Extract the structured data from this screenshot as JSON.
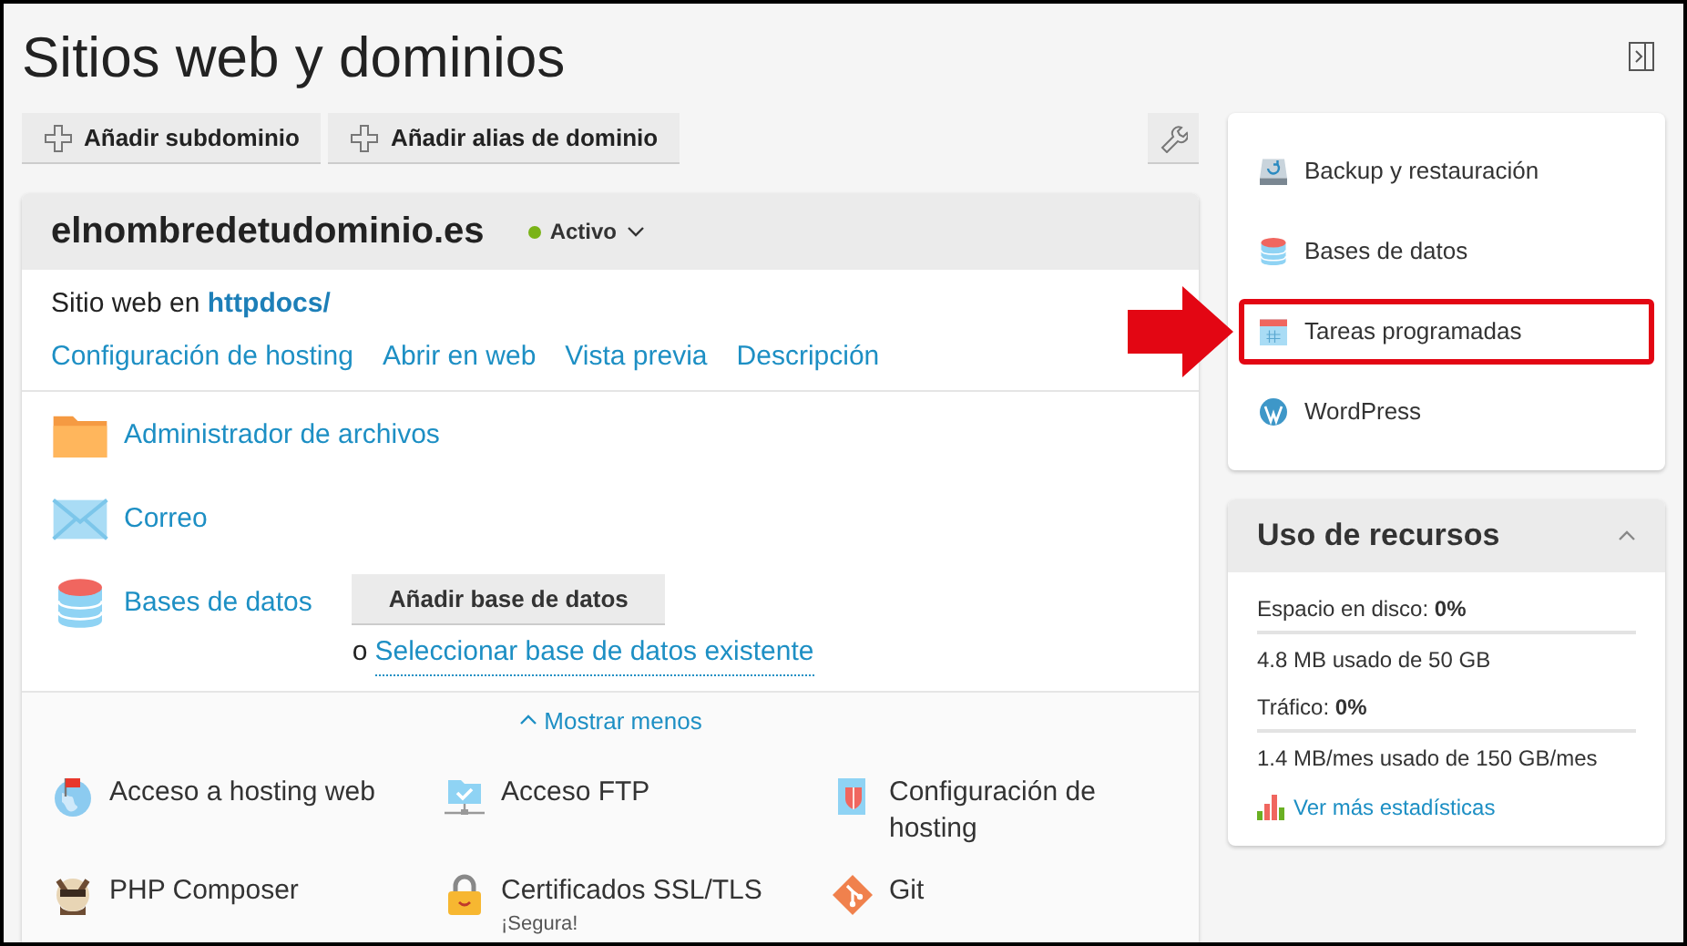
{
  "page": {
    "title": "Sitios web y dominios"
  },
  "toolbar": {
    "buttons": [
      "Añadir subdominio",
      "Añadir alias de dominio"
    ]
  },
  "domain": {
    "name": "elnombredetudominio.es",
    "status": "Activo",
    "site_prefix": "Sitio web en",
    "site_link": "httpdocs/",
    "links": [
      "Configuración de hosting",
      "Abrir en web",
      "Vista previa",
      "Descripción"
    ],
    "services": [
      {
        "kind": "folder",
        "label": "Administrador de archivos"
      },
      {
        "kind": "mail",
        "label": "Correo"
      },
      {
        "kind": "database",
        "label": "Bases de datos",
        "button": "Añadir base de datos",
        "alt_prefix": "o",
        "alt_link": "Seleccionar base de datos existente"
      }
    ],
    "toggle": {
      "label": "Mostrar menos",
      "expanded": true
    },
    "tools": [
      {
        "kind": "globe",
        "label": "Acceso a hosting web"
      },
      {
        "kind": "ftp",
        "label": "Acceso FTP"
      },
      {
        "kind": "scroll",
        "label": "Configuración de hosting"
      },
      {
        "kind": "composer",
        "label": "PHP Composer"
      },
      {
        "kind": "lock",
        "label": "Certificados SSL/TLS",
        "note": "¡Segura!"
      },
      {
        "kind": "git",
        "label": "Git"
      }
    ]
  },
  "sidebar": {
    "items": [
      {
        "kind": "backup",
        "label": "Backup y restauración",
        "highlighted": false
      },
      {
        "kind": "database",
        "label": "Bases de datos",
        "highlighted": false
      },
      {
        "kind": "calendar",
        "label": "Tareas programadas",
        "highlighted": true
      },
      {
        "kind": "wordpress",
        "label": "WordPress",
        "highlighted": false
      }
    ]
  },
  "resources": {
    "title": "Uso de recursos",
    "expanded": true,
    "meters": [
      {
        "label": "Espacio en disco:",
        "value": "0%",
        "level": 0,
        "detail": "4.8 MB usado de 50 GB"
      },
      {
        "label": "Tráfico:",
        "value": "0%",
        "level": 0,
        "detail": "1.4 MB/mes usado de 150 GB/mes"
      }
    ],
    "link": "Ver más estadísticas"
  }
}
